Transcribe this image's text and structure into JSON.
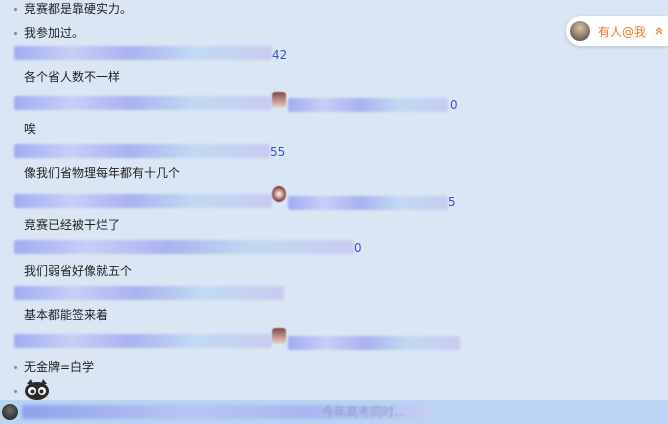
{
  "messages": [
    {
      "text": "竞赛都是靠硬实力。"
    },
    {
      "text": "我参加过。"
    },
    {
      "text": "各个省人数不一样"
    },
    {
      "text": "唉"
    },
    {
      "text": "像我们省物理每年都有十几个"
    },
    {
      "text": "竞赛已经被干烂了"
    },
    {
      "text": "我们弱省好像就五个"
    },
    {
      "text": "基本都能签来着"
    },
    {
      "text": "无金牌=白学"
    }
  ],
  "redacted_fragments": {
    "row1_number": "42",
    "row2_number": "0",
    "row3_number": "55",
    "row4_number": "5",
    "row5_number": "0"
  },
  "mention_pill": {
    "label": "有人@我",
    "icon": "chevron-up-icon"
  },
  "sticker": {
    "icon": "cartoon-face-sticker-icon"
  },
  "bottom_bar": {
    "hidden_text": "今年高考同时..."
  }
}
